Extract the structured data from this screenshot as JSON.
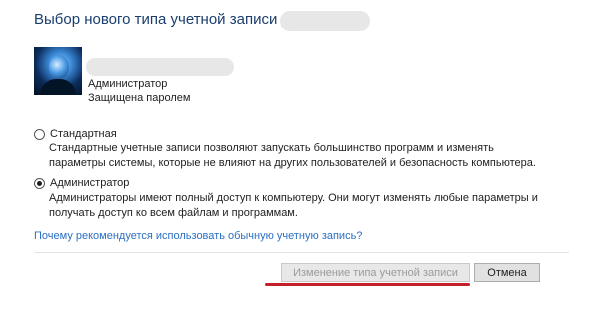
{
  "dialog": {
    "title": "Выбор нового типа учетной записи для"
  },
  "user": {
    "type": "Администратор",
    "status": "Защищена паролем"
  },
  "options": [
    {
      "label": "Стандартная",
      "selected": false,
      "description": "Стандартные учетные записи позволяют запускать большинство программ и изменять параметры системы, которые не влияют на других пользователей и безопасность компьютера."
    },
    {
      "label": "Администратор",
      "selected": true,
      "description": "Администраторы имеют полный доступ к компьютеру. Они могут изменять любые параметры и получать доступ ко всем файлам и программам."
    }
  ],
  "help_link": "Почему рекомендуется использовать обычную учетную запись?",
  "buttons": {
    "change": "Изменение типа учетной записи",
    "cancel": "Отмена"
  },
  "colors": {
    "title": "#1a3e6e",
    "link": "#2b6fc2",
    "annotation": "#c42027"
  }
}
